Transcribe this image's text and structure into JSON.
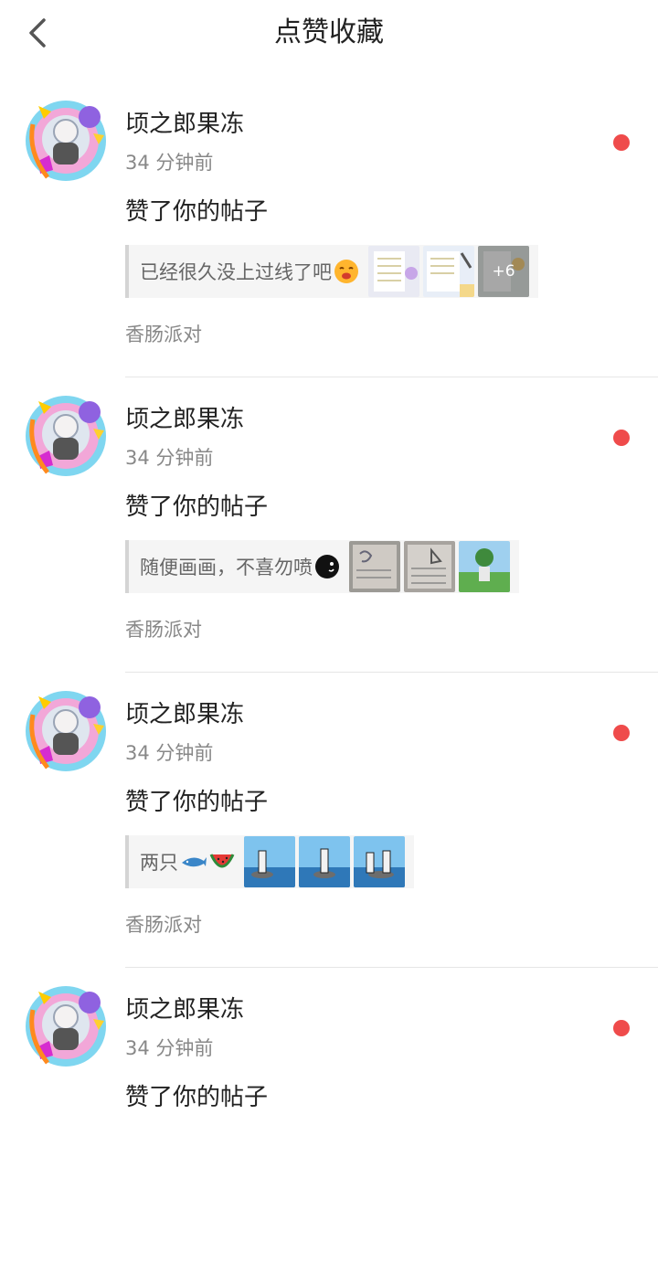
{
  "header": {
    "title": "点赞收藏",
    "back_icon": "chevron-left-icon"
  },
  "colors": {
    "unread_dot": "#ef4b4b",
    "divider": "#e6e6e6",
    "quote_bg": "#f5f5f5"
  },
  "notifications": [
    {
      "user": "顷之郎果冻",
      "time": "34 分钟前",
      "action": "赞了你的帖子",
      "quote": "已经很久没上过线了吧",
      "quote_emoji": "sad-face-emoji",
      "more_count": "+6",
      "forum": "香肠派对"
    },
    {
      "user": "顷之郎果冻",
      "time": "34 分钟前",
      "action": "赞了你的帖子",
      "quote": "随便画画，不喜勿喷",
      "quote_emoji": "black-face-emoji",
      "more_count": "",
      "forum": "香肠派对"
    },
    {
      "user": "顷之郎果冻",
      "time": "34 分钟前",
      "action": "赞了你的帖子",
      "quote": "两只",
      "quote_emoji": "shark-watermelon-emoji",
      "more_count": "",
      "forum": "香肠派对"
    },
    {
      "user": "顷之郎果冻",
      "time": "34 分钟前",
      "action": "赞了你的帖子"
    }
  ]
}
